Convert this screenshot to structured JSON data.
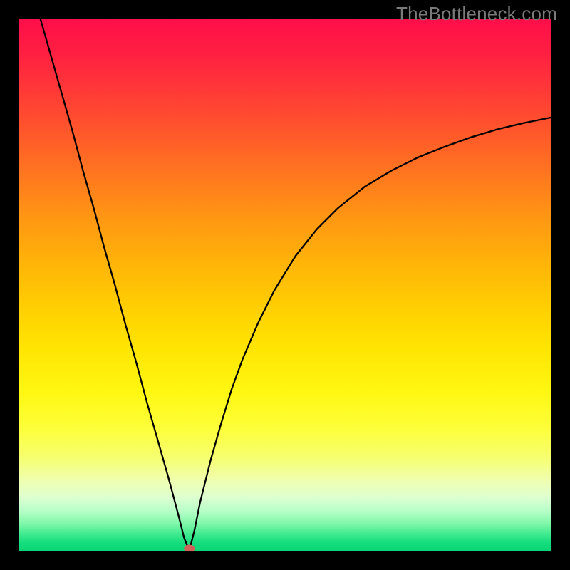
{
  "watermark": "TheBottleneck.com",
  "colors": {
    "frame": "#000000",
    "curve": "#000000",
    "dot": "#d1625a",
    "gradient_top": "#ff0e4a",
    "gradient_bottom": "#0ad574"
  },
  "chart_data": {
    "type": "line",
    "title": "",
    "xlabel": "",
    "ylabel": "",
    "xlim": [
      0,
      100
    ],
    "ylim": [
      0,
      100
    ],
    "note": "Bottleneck-percentage style curve. y ≈ 0 is optimal (green); higher y is worse (red). Left branch is steep/linear; right branch rises and saturates.",
    "minimum": {
      "x": 32,
      "y": 0
    },
    "series": [
      {
        "name": "left-branch",
        "x": [
          4,
          6,
          8,
          10,
          12,
          14,
          16,
          18,
          20,
          22,
          24,
          26,
          28,
          30,
          31,
          32
        ],
        "y": [
          100,
          93,
          86,
          79,
          71.5,
          64.5,
          57,
          50,
          42.5,
          35.5,
          28,
          21,
          14,
          6.5,
          2.5,
          0
        ]
      },
      {
        "name": "right-branch",
        "x": [
          32,
          33,
          34,
          36,
          38,
          40,
          42,
          45,
          48,
          52,
          56,
          60,
          65,
          70,
          75,
          80,
          85,
          90,
          95,
          100
        ],
        "y": [
          0,
          4,
          9,
          17,
          24,
          30.5,
          36,
          43,
          49,
          55.5,
          60.5,
          64.5,
          68.5,
          71.5,
          74,
          76,
          77.8,
          79.3,
          80.5,
          81.5
        ]
      }
    ]
  }
}
